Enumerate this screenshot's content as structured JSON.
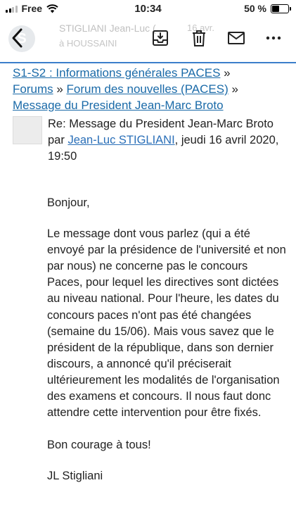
{
  "status_bar": {
    "carrier": "Free",
    "time": "10:34",
    "battery_percent": "50 %",
    "battery_level": 0.5
  },
  "mail_header": {
    "ghost_avatar_letter": "S",
    "ghost_sender": "STIGLIANI Jean-Luc (",
    "ghost_date": "16 avr.",
    "ghost_to": "à HOUSSAINI"
  },
  "breadcrumb": {
    "course": "S1-S2 : Informations générales PACES",
    "sep": " »",
    "forums": "Forums",
    "forum": "Forum des nouvelles (PACES)",
    "thread": "Message du President Jean-Marc Broto"
  },
  "post": {
    "subject": "Re: Message du President Jean-Marc Broto",
    "by": "par ",
    "author": "Jean-Luc STIGLIANI",
    "date": ", jeudi 16 avril 2020, 19:50"
  },
  "message": {
    "greeting": "Bonjour,",
    "paragraph": "Le message dont vous parlez (qui a été envoyé par la présidence de l'université et non par nous) ne concerne pas le concours Paces, pour lequel les directives sont dictées au niveau national. Pour l'heure, les dates du concours paces n'ont pas été changées (semaine du 15/06). Mais vous savez que le président de la république, dans son dernier discours, a annoncé qu'il préciserait ultérieurement les modalités de l'organisation des examens et concours. Il nous faut donc attendre cette intervention pour être fixés.",
    "closing": "Bon courage à tous!",
    "signature": "JL Stigliani"
  },
  "icons": [
    "signal-icon",
    "wifi-icon",
    "battery-icon",
    "back-chevron-icon",
    "archive-icon",
    "trash-icon",
    "mail-icon",
    "more-icon"
  ],
  "colors": {
    "link": "#2a6fb8",
    "accent_line": "#3c7ecb"
  }
}
